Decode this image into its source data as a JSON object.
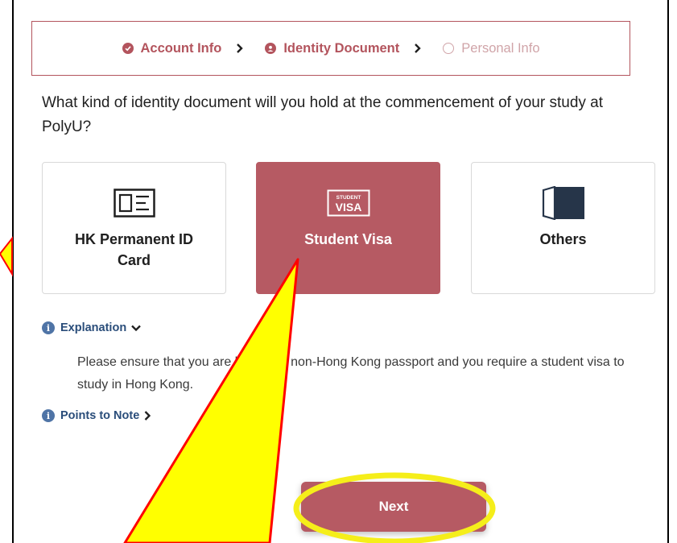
{
  "stepper": {
    "steps": [
      {
        "label": "Account Info",
        "state": "done",
        "icon": "check-circle-icon"
      },
      {
        "label": "Identity Document",
        "state": "current",
        "icon": "user-circle-icon"
      },
      {
        "label": "Personal Info",
        "state": "pending",
        "icon": "empty-circle-icon"
      }
    ]
  },
  "question": "What kind of identity document will you hold at the commencement of your study at PolyU?",
  "options": [
    {
      "label": "HK Permanent ID Card",
      "icon": "id-card-icon",
      "selected": false
    },
    {
      "label": "Student Visa",
      "icon": "student-visa-icon",
      "icon_text_small": "STUDENT",
      "icon_text_large": "VISA",
      "selected": true
    },
    {
      "label": "Others",
      "icon": "passport-book-icon",
      "selected": false
    }
  ],
  "explanation": {
    "label": "Explanation",
    "expanded": true,
    "text": "Please ensure that you are holding a non-Hong Kong passport and you require a student visa to study in Hong Kong."
  },
  "points_to_note": {
    "label": "Points to Note",
    "expanded": false
  },
  "next_button": {
    "label": "Next"
  },
  "colors": {
    "accent": "#b65a63",
    "link": "#2a4d7a",
    "annotation_fill": "#ffff00",
    "annotation_stroke": "#ff0000",
    "highlight_ellipse": "#f5ee1a"
  }
}
